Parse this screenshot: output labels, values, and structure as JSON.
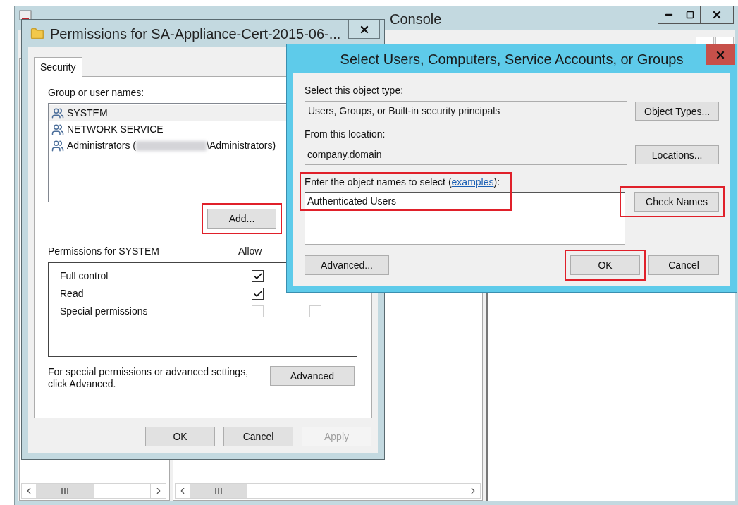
{
  "console": {
    "title": "Console"
  },
  "permissions_dialog": {
    "title": "Permissions for SA-Appliance-Cert-2015-06-...",
    "tabs": [
      {
        "label": "Security",
        "selected": true
      }
    ],
    "group_label": "Group or user names:",
    "users": [
      {
        "name": "SYSTEM",
        "selected": true
      },
      {
        "name": "NETWORK SERVICE",
        "selected": false
      },
      {
        "name": "Administrators (",
        "name_end": "\\Administrators)",
        "selected": false,
        "redacted": true
      }
    ],
    "add_button": {
      "label": "Add...",
      "highlighted": true
    },
    "permissions_label": "Permissions for SYSTEM",
    "allow_header": "Allow",
    "permissions": [
      {
        "name": "Full control",
        "allow": true,
        "disabled": false
      },
      {
        "name": "Read",
        "allow": true,
        "disabled": false
      },
      {
        "name": "Special permissions",
        "allow": false,
        "deny": false,
        "disabled": true
      }
    ],
    "advanced_note": "For special permissions or advanced settings, click Advanced.",
    "advanced_button": "Advanced",
    "buttons": [
      {
        "label": "OK",
        "disabled": false
      },
      {
        "label": "Cancel",
        "disabled": false
      },
      {
        "label": "Apply",
        "disabled": true
      }
    ]
  },
  "select_dialog": {
    "title": "Select Users, Computers, Service Accounts, or Groups",
    "object_type_label": "Select this object type:",
    "object_type_value": "Users, Groups, or Built-in security principals",
    "object_types_button": "Object Types...",
    "location_label": "From this location:",
    "location_value": "company.domain",
    "locations_button": "Locations...",
    "names_label": "Enter the object names to select (",
    "names_link": "examples",
    "names_label_end": "):",
    "names_highlighted": true,
    "names_value": "Authenticated Users",
    "check_names_button": {
      "label": "Check Names",
      "highlighted": true
    },
    "advanced_button": {
      "label": "Advanced...",
      "highlighted": false
    },
    "ok_button": {
      "label": "OK",
      "highlighted": true
    },
    "cancel_button": {
      "label": "Cancel",
      "highlighted": false
    }
  }
}
